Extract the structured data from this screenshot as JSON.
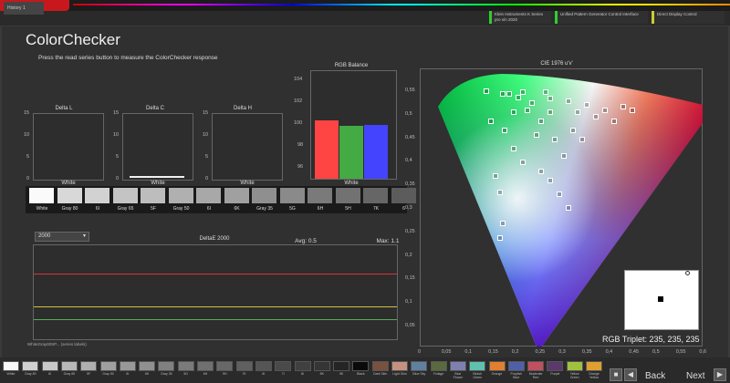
{
  "app": {
    "logo": "calman",
    "tab": "History 1"
  },
  "devices": [
    {
      "label": "Klein Instruments K Series",
      "sub": "pro s/n 2020",
      "color": "#33cc33"
    },
    {
      "label": "Unified Pattern Generator Control Interface",
      "sub": "",
      "color": "#33cc33"
    },
    {
      "label": "Direct Display Control",
      "sub": "",
      "color": "#cccc33"
    }
  ],
  "page": {
    "title": "ColorChecker",
    "subtitle": "Press the read series button to measure the ColorChecker response"
  },
  "delta_l": {
    "title": "Delta L",
    "ticks": [
      "15",
      "10",
      "5",
      "0"
    ],
    "footer": "White"
  },
  "delta_c": {
    "title": "Delta C",
    "ticks": [
      "15",
      "10",
      "5",
      "0"
    ],
    "footer": "White"
  },
  "delta_h": {
    "title": "Delta H",
    "ticks": [
      "15",
      "10",
      "5",
      "0"
    ],
    "footer": "White"
  },
  "rgb_balance": {
    "title": "RGB Balance",
    "ticks": [
      "104",
      "102",
      "100",
      "98",
      "96"
    ],
    "footer": "White",
    "values": [
      {
        "name": "R",
        "value": 100.4,
        "color": "#ff4444"
      },
      {
        "name": "G",
        "value": 99.9,
        "color": "#44aa44"
      },
      {
        "name": "B",
        "value": 100.0,
        "color": "#4444ff"
      }
    ],
    "ylim": [
      95,
      105
    ]
  },
  "swatches": {
    "labels": [
      "White",
      "Gray 80",
      "6I",
      "Gray 65",
      "5F",
      "Gray 50",
      "6I",
      "6K",
      "Gray 35",
      "5G",
      "6H",
      "5H",
      "7K",
      "6"
    ],
    "colors": [
      "#fafafa",
      "#d8d8d8",
      "#d2d2d2",
      "#c4c4c4",
      "#bdbdbd",
      "#b0b0b0",
      "#a8a8a8",
      "#a0a0a0",
      "#8f8f8f",
      "#8a8a8a",
      "#7a7a7a",
      "#727272",
      "#666666",
      "#5c5c5c"
    ]
  },
  "deltae": {
    "dropdown": "2000",
    "title": "DeltaE 2000",
    "avg": "Avg: 0.5",
    "max": "Max: 1.1",
    "xlabels": "WhiteGray80SP... (series labels)"
  },
  "cie": {
    "title": "CIE 1976 u'v'",
    "yticks": [
      "0,55",
      "0,5",
      "0,45",
      "0,4",
      "0,35",
      "0,3",
      "0,25",
      "0,2",
      "0,15",
      "0,1",
      "0,05"
    ],
    "xticks": [
      "0",
      "0,05",
      "0,1",
      "0,15",
      "0,2",
      "0,25",
      "0,3",
      "0,35",
      "0,4",
      "0,45",
      "0,5",
      "0,55",
      "0,6"
    ],
    "rgb_triplet": "RGB Triplet: 235, 235, 235"
  },
  "bottom": {
    "swatches": [
      {
        "label": "White",
        "color": "#fafafa"
      },
      {
        "label": "Gray 80",
        "color": "#d0d0d0"
      },
      {
        "label": "6I",
        "color": "#c8c8c8"
      },
      {
        "label": "Gray 65",
        "color": "#b8b8b8"
      },
      {
        "label": "5F",
        "color": "#b0b0b0"
      },
      {
        "label": "Gray 50",
        "color": "#a0a0a0"
      },
      {
        "label": "6I",
        "color": "#999"
      },
      {
        "label": "6K",
        "color": "#909090"
      },
      {
        "label": "Gray 35",
        "color": "#808080"
      },
      {
        "label": "5G",
        "color": "#7a7a7a"
      },
      {
        "label": "6H",
        "color": "#707070"
      },
      {
        "label": "5H",
        "color": "#686868"
      },
      {
        "label": "7K",
        "color": "#606060"
      },
      {
        "label": "6I",
        "color": "#555"
      },
      {
        "label": "7I",
        "color": "#4a4a4a"
      },
      {
        "label": "8I",
        "color": "#404040"
      },
      {
        "label": "8K",
        "color": "#353535"
      },
      {
        "label": "9K",
        "color": "#252525"
      },
      {
        "label": "Black",
        "color": "#0a0a0a"
      },
      {
        "label": "Dark Skin",
        "color": "#7a5040"
      },
      {
        "label": "Light Skin",
        "color": "#c49080"
      },
      {
        "label": "Blue Sky",
        "color": "#6080a0"
      },
      {
        "label": "Foliage",
        "color": "#5a6a40"
      },
      {
        "label": "Blue Flower",
        "color": "#8080b0"
      },
      {
        "label": "Bluish Green",
        "color": "#60c0b0"
      },
      {
        "label": "Orange",
        "color": "#e08030"
      },
      {
        "label": "Purplish Blue",
        "color": "#5060a8"
      },
      {
        "label": "Moderate Red",
        "color": "#c05060"
      },
      {
        "label": "Purple",
        "color": "#5a3a6a"
      },
      {
        "label": "Yellow Green",
        "color": "#a0c040"
      },
      {
        "label": "Orange Yellow",
        "color": "#e0a030"
      }
    ],
    "back": "Back",
    "next": "Next"
  }
}
